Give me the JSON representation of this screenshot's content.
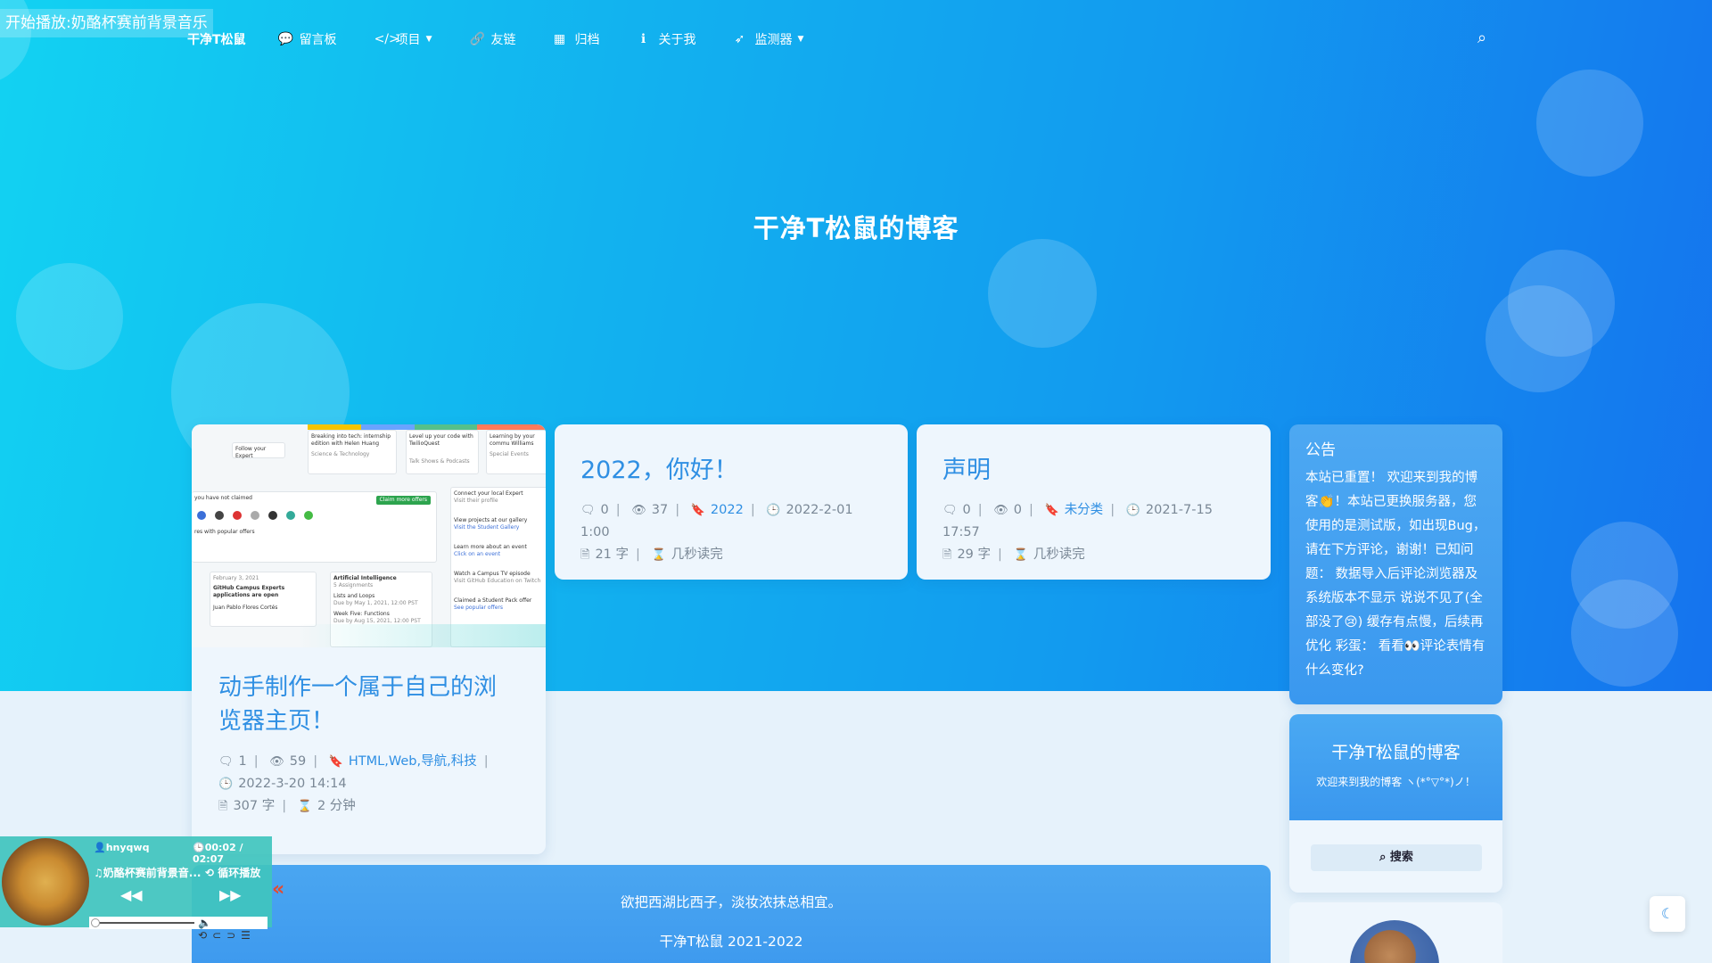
{
  "music_banner": "开始播放:奶酪杯赛前背景音乐",
  "nav": {
    "brand": "干净T松鼠",
    "items": [
      {
        "label": "留言板",
        "icon": "comments-icon"
      },
      {
        "label": "项目",
        "icon": "code-icon"
      },
      {
        "label": "友链",
        "icon": "link-icon"
      },
      {
        "label": "归档",
        "icon": "calendar-icon"
      },
      {
        "label": "关于我",
        "icon": "info-icon"
      },
      {
        "label": "监测器",
        "icon": "rocket-icon"
      }
    ]
  },
  "site_title": "干净T松鼠的博客",
  "posts": [
    {
      "title": "动手制作一个属于自己的浏览器主页！",
      "comments": "1",
      "views": "59",
      "tags": "HTML,Web,导航,科技",
      "date": "2022-3-20 14:14",
      "words": "307 字",
      "read": "2 分钟",
      "thumb": {
        "box1_title": "Follow your Expert",
        "box2_title": "Breaking into tech: internship edition with Helen Huang",
        "box2_sub": "Science & Technology",
        "box3_title": "Level up your code with TwilioQuest",
        "box3_sub": "Talk Shows & Podcasts",
        "box4_title": "Learning by your commu Williams",
        "box4_sub": "Special Events",
        "claim_text": "you have not claimed",
        "claim_btn": "Claim more offers",
        "popular": "res with popular offers",
        "date_box_date": "February 3, 2021",
        "date_box_title": "GitHub Campus Experts applications are open",
        "date_box_author": "Juan Pablo Flores Cortés",
        "ai_title": "Artificial Intelligence",
        "ai_sub": "5 Assignments",
        "ai_item1": "Lists and Loops",
        "ai_item1_due": "Due by May 1, 2021, 12:00 PST",
        "ai_item2": "Week Five: Functions",
        "ai_item2_due": "Due by Aug 15, 2021, 12:00 PST",
        "right1": "Connect your local Expert",
        "right1_sub": "Visit their profile",
        "right2": "View projects at our gallery",
        "right2_sub": "Visit the Student Gallery",
        "right3": "Learn more about an event",
        "right3_sub": "Click on an event",
        "right4": "Watch a Campus TV episode",
        "right4_sub": "Visit GitHub Education on Twitch",
        "right5": "Claimed a Student Pack offer",
        "right5_sub": "See popular offers"
      }
    },
    {
      "title": "2022，你好！",
      "comments": "0",
      "views": "37",
      "tags": "2022",
      "date": "2022-2-01 1:00",
      "words": "21 字",
      "read": "几秒读完"
    },
    {
      "title": "声明",
      "comments": "0",
      "views": "0",
      "tags": "未分类",
      "date": "2021-7-15 17:57",
      "words": "29 字",
      "read": "几秒读完"
    }
  ],
  "notice": {
    "title": "公告",
    "text": "本站已重置！ 欢迎来到我的博客👏！本站已更换服务器，您使用的是测试版，如出现Bug，请在下方评论，谢谢！已知问题： 数据导入后评论浏览器及系统版本不显示 说说不见了(全部没了😢) 缓存有点慢，后续再优化 彩蛋： 看看👀评论表情有什么变化?"
  },
  "profile": {
    "name": "干净T松鼠的博客",
    "welcome": "欢迎来到我的博客 ヽ(*°▽°*)ノ！",
    "search_label": "搜索"
  },
  "footer": {
    "poem": "欲把西湖比西子，淡妆浓抹总相宜。",
    "brand": "干净T松鼠",
    "years": "2021-2022"
  },
  "player": {
    "author": "hnyqwq",
    "time": "00:02 / 02:07",
    "song": "奶酪杯赛前背景音...",
    "mode": "循环播放",
    "progress": 0.016
  },
  "colors": {
    "accent": "#2f8fe3",
    "hero_start": "#12d2f2",
    "hero_end": "#1573ee",
    "player_bg": "#40c4be"
  }
}
